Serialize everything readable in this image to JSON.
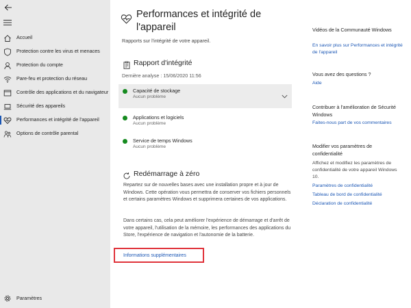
{
  "sidebar": {
    "items": [
      {
        "label": "Accueil",
        "icon": "home-icon"
      },
      {
        "label": "Protection contre les virus et menaces",
        "icon": "shield-icon"
      },
      {
        "label": "Protection du compte",
        "icon": "person-icon"
      },
      {
        "label": "Pare-feu et protection du réseau",
        "icon": "wifi-icon"
      },
      {
        "label": "Contrôle des applications et du navigateur",
        "icon": "app-window-icon"
      },
      {
        "label": "Sécurité des appareils",
        "icon": "laptop-icon"
      },
      {
        "label": "Performances et intégrité de l'appareil",
        "icon": "heart-pulse-icon",
        "active": true
      },
      {
        "label": "Options de contrôle parental",
        "icon": "family-icon"
      }
    ],
    "settings_label": "Paramètres"
  },
  "main": {
    "title": "Performances et intégrité de l'appareil",
    "subtitle": "Rapports sur l'intégrité de votre appareil.",
    "health_report": {
      "title": "Rapport d'intégrité",
      "last_scan": "Dernière analyse : 15/06/2020 11:56",
      "items": [
        {
          "title": "Capacité de stockage",
          "status": "Aucun problème"
        },
        {
          "title": "Applications et logiciels",
          "status": "Aucun problème"
        },
        {
          "title": "Service de temps Windows",
          "status": "Aucun problème"
        }
      ]
    },
    "fresh_start": {
      "title": "Redémarrage à zéro",
      "paragraph1": "Repartez sur de nouvelles bases avec une installation propre et à jour de Windows. Cette opération vous permettra de conserver vos fichiers personnels et certains paramètres Windows et supprimera certaines de vos applications.",
      "paragraph2": "Dans certains cas, cela peut améliorer l'expérience de démarrage et d'arrêt de votre appareil, l'utilisation de la mémoire, les performances des applications du Store, l'expérience de navigation et l'autonomie de la batterie.",
      "more_info_link": "Informations supplémentaires"
    }
  },
  "right_column": {
    "community": {
      "heading": "Vidéos de la Communauté Windows",
      "link": "En savoir plus sur Performances et intégrité de l'appareil"
    },
    "questions": {
      "heading": "Vous avez des questions ?",
      "link": "Aide"
    },
    "improve": {
      "heading": "Contribuer à l'amélioration de Sécurité Windows",
      "link": "Faites-nous part de vos commentaires"
    },
    "privacy": {
      "heading": "Modifier vos paramètres de confidentialité",
      "text": "Affichez et modifiez les paramètres de confidentialité de votre appareil Windows 10.",
      "links": [
        "Paramètres de confidentialité",
        "Tableau de bord de confidentialité",
        "Déclaration de confidentialité"
      ]
    }
  },
  "colors": {
    "accent": "#1a56b4",
    "sidebar_bg": "#e9e9e9",
    "check_green": "#158a1f",
    "highlight_red": "#e0323a"
  }
}
